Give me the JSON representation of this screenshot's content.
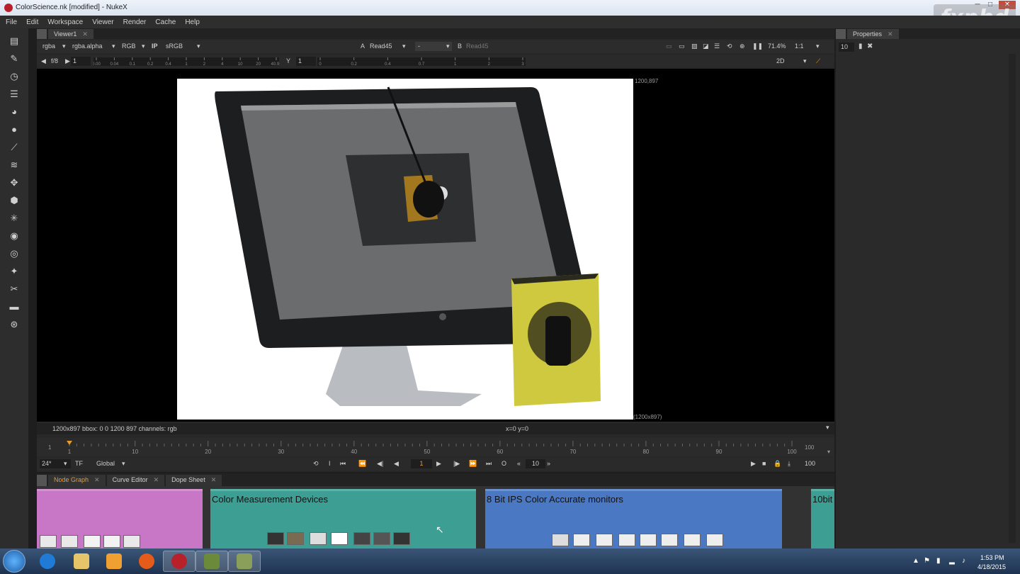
{
  "window": {
    "title": "ColorScience.nk [modified] - NukeX",
    "min": "─",
    "max": "□",
    "close": "✕"
  },
  "watermark": "fxphd",
  "menu": [
    "File",
    "Edit",
    "Workspace",
    "Viewer",
    "Render",
    "Cache",
    "Help"
  ],
  "viewer": {
    "tab": "Viewer1",
    "channels": "rgba",
    "alpha": "rgba.alpha",
    "rgb": "RGB",
    "ip": "IP",
    "lut": "sRGB",
    "a_label": "A",
    "a_input": "Read45",
    "ab_mode": "-",
    "b_label": "B",
    "b_input": "Read45",
    "zoom": "71.4%",
    "ratio": "1:1",
    "mode": "2D",
    "fstop_label": "f/8",
    "frame_label": "1",
    "y_label": "Y",
    "y_value": "1",
    "gain_ticks": [
      "0.00",
      "0.04",
      "0.1",
      "0.2",
      "0.4",
      "1",
      "2",
      "4",
      "10",
      "20",
      "40.99"
    ],
    "gamma_ticks": [
      "0",
      "0.2",
      "0.4",
      "0.7",
      "1",
      "2",
      "3"
    ],
    "res_top": "1200,897",
    "res_bottom": "(1200x897)",
    "info_left": "1200x897  bbox: 0 0 1200 897 channels: rgb",
    "info_center": "x=0 y=0"
  },
  "timeline": {
    "start": "1",
    "end": "100",
    "ticks": [
      "1",
      "10",
      "20",
      "30",
      "40",
      "50",
      "60",
      "70",
      "80",
      "90",
      "100"
    ],
    "current": "1"
  },
  "transport": {
    "fps": "24*",
    "tf": "TF",
    "global": "Global",
    "frame": "1",
    "step": "10",
    "end": "100"
  },
  "nodegraph": {
    "tabs": [
      {
        "label": "Node Graph",
        "x": "✕"
      },
      {
        "label": "Curve Editor",
        "x": "✕"
      },
      {
        "label": "Dope Sheet",
        "x": "✕"
      }
    ],
    "backdrops": [
      {
        "label": "",
        "color": "#c877c6"
      },
      {
        "label": "Color Measurement Devices",
        "color": "#3d9e93"
      },
      {
        "label": "8 Bit IPS Color Accurate monitors",
        "color": "#4a78c2"
      },
      {
        "label": "10bit",
        "color": "#3d9e93"
      }
    ]
  },
  "properties": {
    "title": "Properties",
    "max_panels": "10"
  },
  "clock": {
    "time": "1:53 PM",
    "date": "4/18/2015"
  }
}
